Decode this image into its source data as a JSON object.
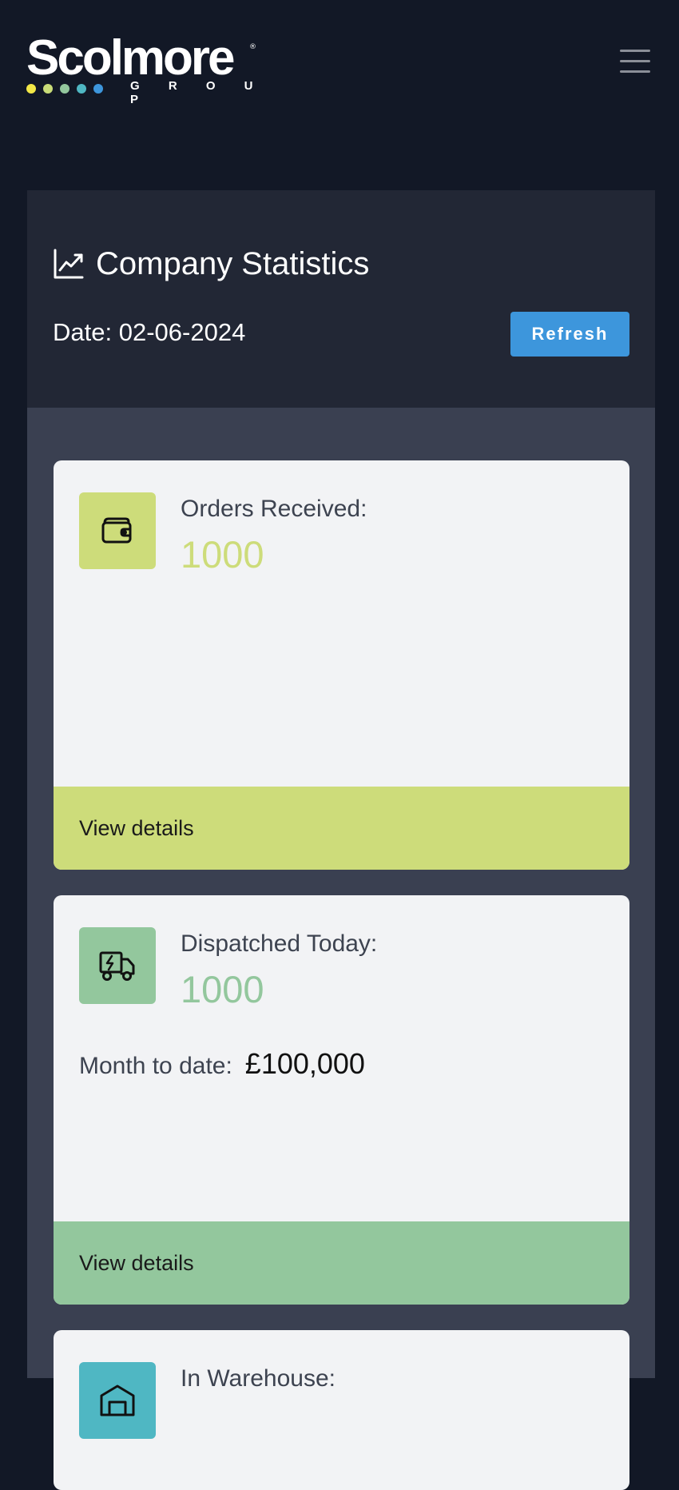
{
  "header": {
    "logo": {
      "word": "Scolmore",
      "registered": "®",
      "subtitle": "G R O U P",
      "dot_colors": [
        "#f3e847",
        "#c9dc78",
        "#93c79d",
        "#4fb7c3",
        "#3d96dc"
      ]
    },
    "menu_icon": "hamburger-menu-icon"
  },
  "stats": {
    "icon": "line-chart-icon",
    "title": "Company Statistics",
    "date_label": "Date:",
    "date_value": "02-06-2024",
    "refresh_label": "Refresh"
  },
  "cards": [
    {
      "icon": "wallet-icon",
      "label": "Orders Received:",
      "value": "1000",
      "accent": "#cddc7a",
      "footer_label": "View details"
    },
    {
      "icon": "delivery-truck-icon",
      "label": "Dispatched Today:",
      "value": "1000",
      "accent": "#93c79d",
      "mtd_label": "Month to date:",
      "mtd_value": "£100,000",
      "footer_label": "View details"
    },
    {
      "icon": "warehouse-icon",
      "label": "In Warehouse:",
      "accent": "#4fb7c3"
    }
  ],
  "colors": {
    "background": "#121826",
    "panel_head": "#222735",
    "panel_body": "#3a4051",
    "card_bg": "#f2f3f5",
    "refresh": "#3d96dc"
  }
}
